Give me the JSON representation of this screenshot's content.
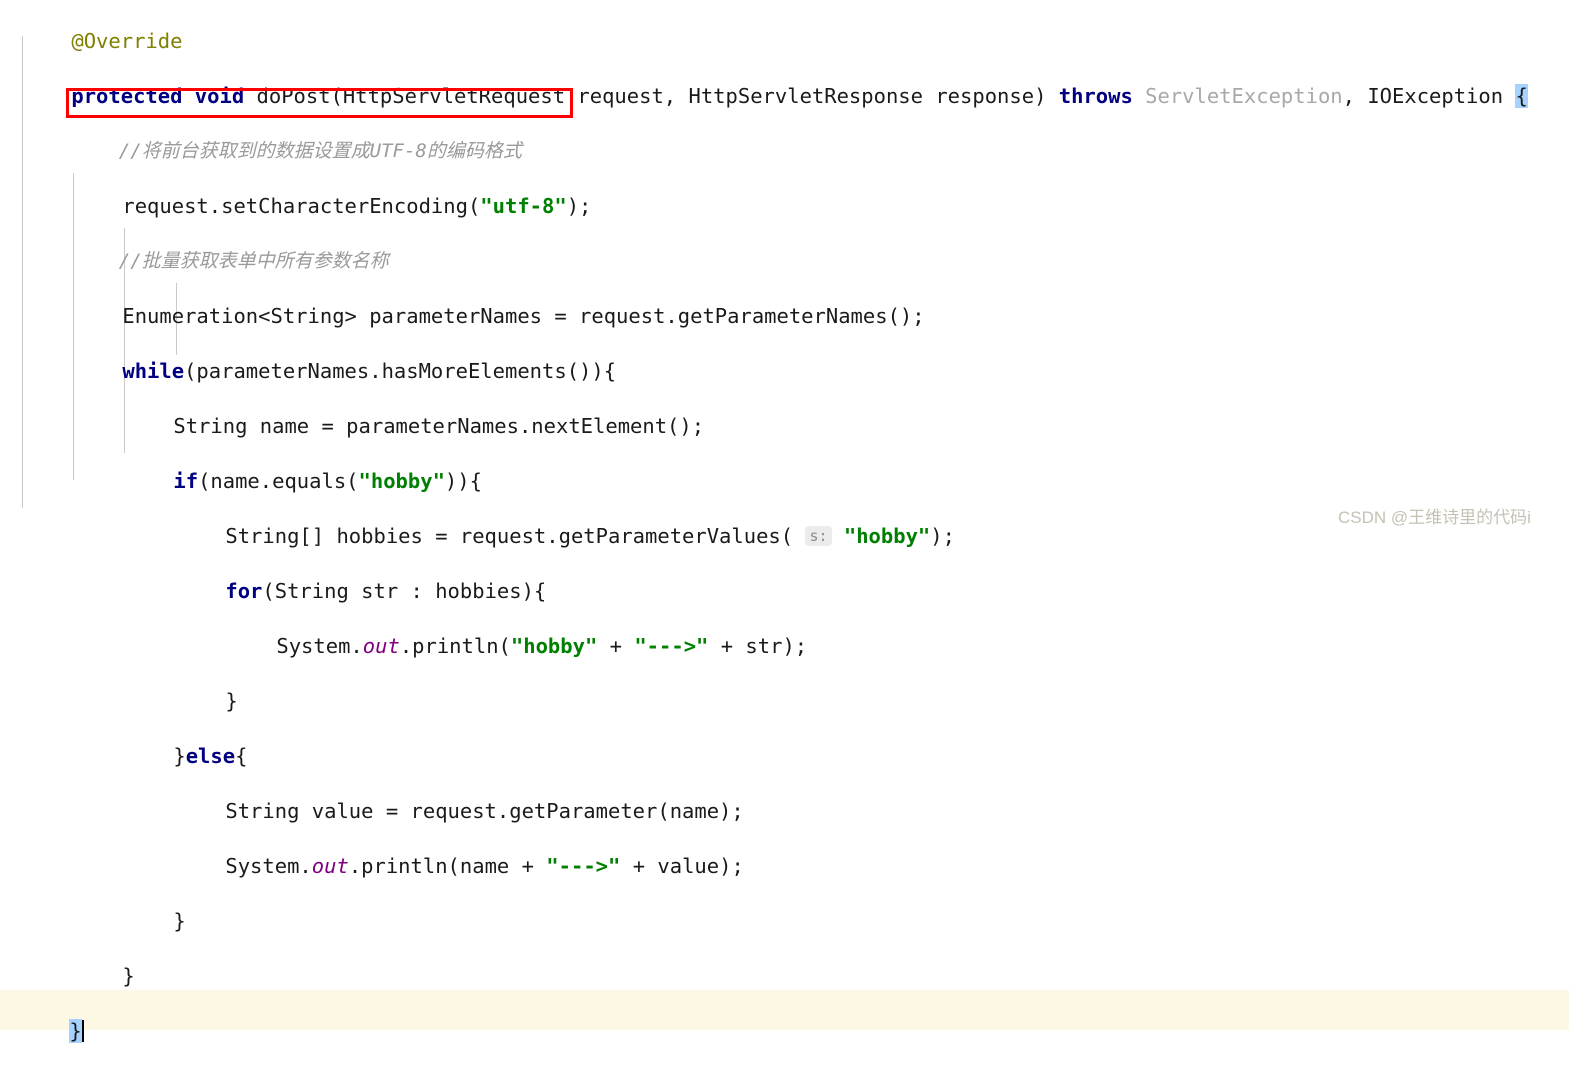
{
  "editor": {
    "language": "java",
    "background_color": "#ffffff",
    "current_line_color": "#fdf8e3",
    "indent_guide_color": "#c9c9c9",
    "caret_color": "#000000",
    "bracket_match_color": "#a6d2ff",
    "colors": {
      "keyword": "#000080",
      "annotation": "#808000",
      "string": "#008000",
      "comment": "#9a9a9a",
      "static_field": "#800080",
      "dimmed_identifier": "#a8a8a8",
      "plain_text": "#1a1a1a",
      "param_hint_bg": "#ebebeb",
      "param_hint_fg": "#8c8c8c",
      "annotation_box": "#ff0000"
    },
    "lines": [
      {
        "n": 1,
        "indent": 1,
        "text": "@Override"
      },
      {
        "n": 2,
        "indent": 1,
        "text": "protected void doPost(HttpServletRequest request, HttpServletResponse response) throws ServletException, IOException {"
      },
      {
        "n": 3,
        "indent": 2,
        "text": "//将前台获取到的数据设置成UTF-8的编码格式"
      },
      {
        "n": 4,
        "indent": 2,
        "text": "request.setCharacterEncoding(\"utf-8\");"
      },
      {
        "n": 5,
        "indent": 2,
        "text": "//批量获取表单中所有参数名称"
      },
      {
        "n": 6,
        "indent": 2,
        "text": "Enumeration<String> parameterNames = request.getParameterNames();"
      },
      {
        "n": 7,
        "indent": 2,
        "text": "while(parameterNames.hasMoreElements()){"
      },
      {
        "n": 8,
        "indent": 3,
        "text": "String name = parameterNames.nextElement();"
      },
      {
        "n": 9,
        "indent": 3,
        "text": "if(name.equals(\"hobby\")){"
      },
      {
        "n": 10,
        "indent": 4,
        "text": "String[] hobbies = request.getParameterValues( s: \"hobby\");"
      },
      {
        "n": 11,
        "indent": 4,
        "text": "for(String str : hobbies){"
      },
      {
        "n": 12,
        "indent": 5,
        "text": "System.out.println(\"hobby\" + \"--->\" + str);"
      },
      {
        "n": 13,
        "indent": 4,
        "text": "}"
      },
      {
        "n": 14,
        "indent": 3,
        "text": "}else{"
      },
      {
        "n": 15,
        "indent": 4,
        "text": "String value = request.getParameter(name);"
      },
      {
        "n": 16,
        "indent": 4,
        "text": "System.out.println(name + \"--->\" + value);"
      },
      {
        "n": 17,
        "indent": 3,
        "text": "}"
      },
      {
        "n": 18,
        "indent": 2,
        "text": "}"
      },
      {
        "n": 19,
        "indent": 1,
        "text": "}"
      }
    ],
    "tokens": {
      "annotation_override": "@Override",
      "kw_protected": "protected",
      "kw_void": "void",
      "kw_throws": "throws",
      "kw_while": "while",
      "kw_if": "if",
      "kw_for": "for",
      "kw_else": "else",
      "method_dopost": "doPost",
      "type_httpservletrequest": "HttpServletRequest",
      "type_httpservletresponse": "HttpServletResponse",
      "var_request": "request",
      "var_response": "response",
      "type_servletexception": "ServletException",
      "type_ioexception": "IOException",
      "open_brace": "{",
      "close_brace": "}",
      "str_utf8": "\"utf-8\"",
      "str_hobby": "\"hobby\"",
      "str_arrow": "\"--->\"",
      "param_hint_s": "s:",
      "type_enumeration_string": "Enumeration<String>",
      "var_parameternames": "parameterNames",
      "call_getparameternames": "request.getParameterNames()",
      "call_hasmoreelements": "parameterNames.hasMoreElements()",
      "call_nextelement": "parameterNames.nextElement()",
      "call_setcharacterencoding": "request.setCharacterEncoding",
      "call_getparametervalues": "request.getParameterValues",
      "call_getparameter": "request.getParameter",
      "type_string": "String",
      "type_string_array": "String[]",
      "var_name": "name",
      "var_value": "value",
      "var_hobbies": "hobbies",
      "var_str": "str",
      "system_out": "System.out",
      "method_println": "println",
      "equals_method": ".equals"
    },
    "comments": {
      "encoding": "//将前台获取到的数据设置成UTF-8的编码格式",
      "batch_params": "//批量获取表单中所有参数名称"
    }
  },
  "annotation_box": {
    "target_line": 4,
    "target_text": "request.setCharacterEncoding(\"utf-8\");",
    "color": "#ff0000"
  },
  "watermark": {
    "text": "CSDN @王维诗里的代码i"
  }
}
